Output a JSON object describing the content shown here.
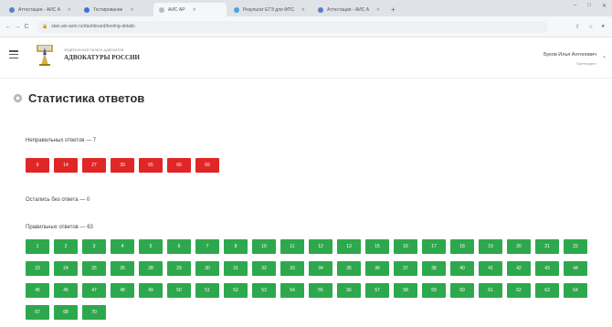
{
  "browser": {
    "tabs": [
      {
        "title": "Аттестация - АИС АР",
        "color": "#5a7fc8",
        "active": false
      },
      {
        "title": "Тестирование",
        "color": "#3a74d8",
        "active": false
      },
      {
        "title": "АИС АР",
        "color": "#bbbbbb",
        "active": true
      },
      {
        "title": "Результат ЕГЭ для ФПС — ОнеД...",
        "color": "#4aa3df",
        "active": false
      },
      {
        "title": "Аттестация - АИС АР",
        "color": "#5a7fc8",
        "active": false
      }
    ],
    "new_tab": "+",
    "url": "stan.ais-asm.ru/dashboard/testing-details",
    "nav": {
      "back": "←",
      "forward": "→",
      "reload": "C"
    },
    "window_controls": [
      "–",
      "□",
      "✕"
    ]
  },
  "header": {
    "logo_small": "ФЕДЕРАЛЬНАЯ ПАЛАТА АДВОКАТОВ",
    "logo_big": "АДВОКАТУРЫ РОССИИ",
    "user_name": "Буков Илья Антонович",
    "user_role": "Претендент"
  },
  "page": {
    "title": "Статистика ответов"
  },
  "sections": {
    "wrong": {
      "label": "Неправильных ответов — 7",
      "items": [
        "9",
        "14",
        "27",
        "39",
        "65",
        "66",
        "69"
      ]
    },
    "unanswered": {
      "label": "Остались без ответа — 0"
    },
    "correct": {
      "label": "Правильных ответов — 63",
      "items": [
        "1",
        "2",
        "3",
        "4",
        "5",
        "6",
        "7",
        "8",
        "10",
        "11",
        "12",
        "13",
        "15",
        "16",
        "17",
        "18",
        "19",
        "20",
        "21",
        "22",
        "23",
        "24",
        "25",
        "26",
        "28",
        "29",
        "30",
        "31",
        "32",
        "33",
        "34",
        "35",
        "36",
        "37",
        "38",
        "40",
        "41",
        "42",
        "43",
        "44",
        "45",
        "46",
        "47",
        "48",
        "49",
        "50",
        "51",
        "52",
        "53",
        "54",
        "55",
        "56",
        "57",
        "58",
        "59",
        "60",
        "61",
        "62",
        "63",
        "64",
        "67",
        "68",
        "70"
      ]
    }
  },
  "colors": {
    "wrong": "#e02626",
    "correct": "#2ea84c"
  }
}
